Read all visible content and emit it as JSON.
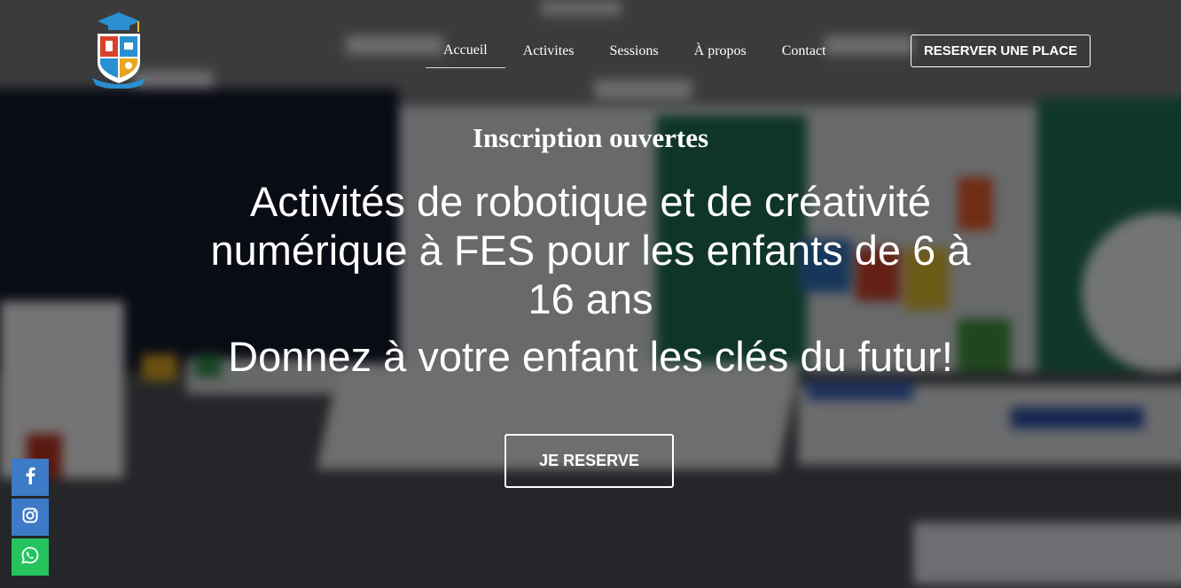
{
  "nav": {
    "items": [
      {
        "label": "Accueil",
        "active": true
      },
      {
        "label": "Activites",
        "active": false
      },
      {
        "label": "Sessions",
        "active": false
      },
      {
        "label": "À propos",
        "active": false
      },
      {
        "label": "Contact",
        "active": false
      }
    ],
    "reserve_button": "RESERVER UNE PLACE"
  },
  "hero": {
    "subtitle": "Inscription ouvertes",
    "headline": "Activités de robotique et de créativité numérique à FES pour les enfants de 6 à 16 ans",
    "tagline": "Donnez à votre enfant les clés du futur!",
    "cta_label": "JE RESERVE"
  },
  "social": [
    {
      "name": "facebook",
      "icon": "facebook-icon",
      "color": "#3d7ac7"
    },
    {
      "name": "instagram",
      "icon": "instagram-icon",
      "color": "#3d7ac7"
    },
    {
      "name": "whatsapp",
      "icon": "whatsapp-icon",
      "color": "#25c35e"
    }
  ],
  "colors": {
    "overlay": "rgba(0,0,0,0.5)",
    "text": "#ffffff"
  }
}
